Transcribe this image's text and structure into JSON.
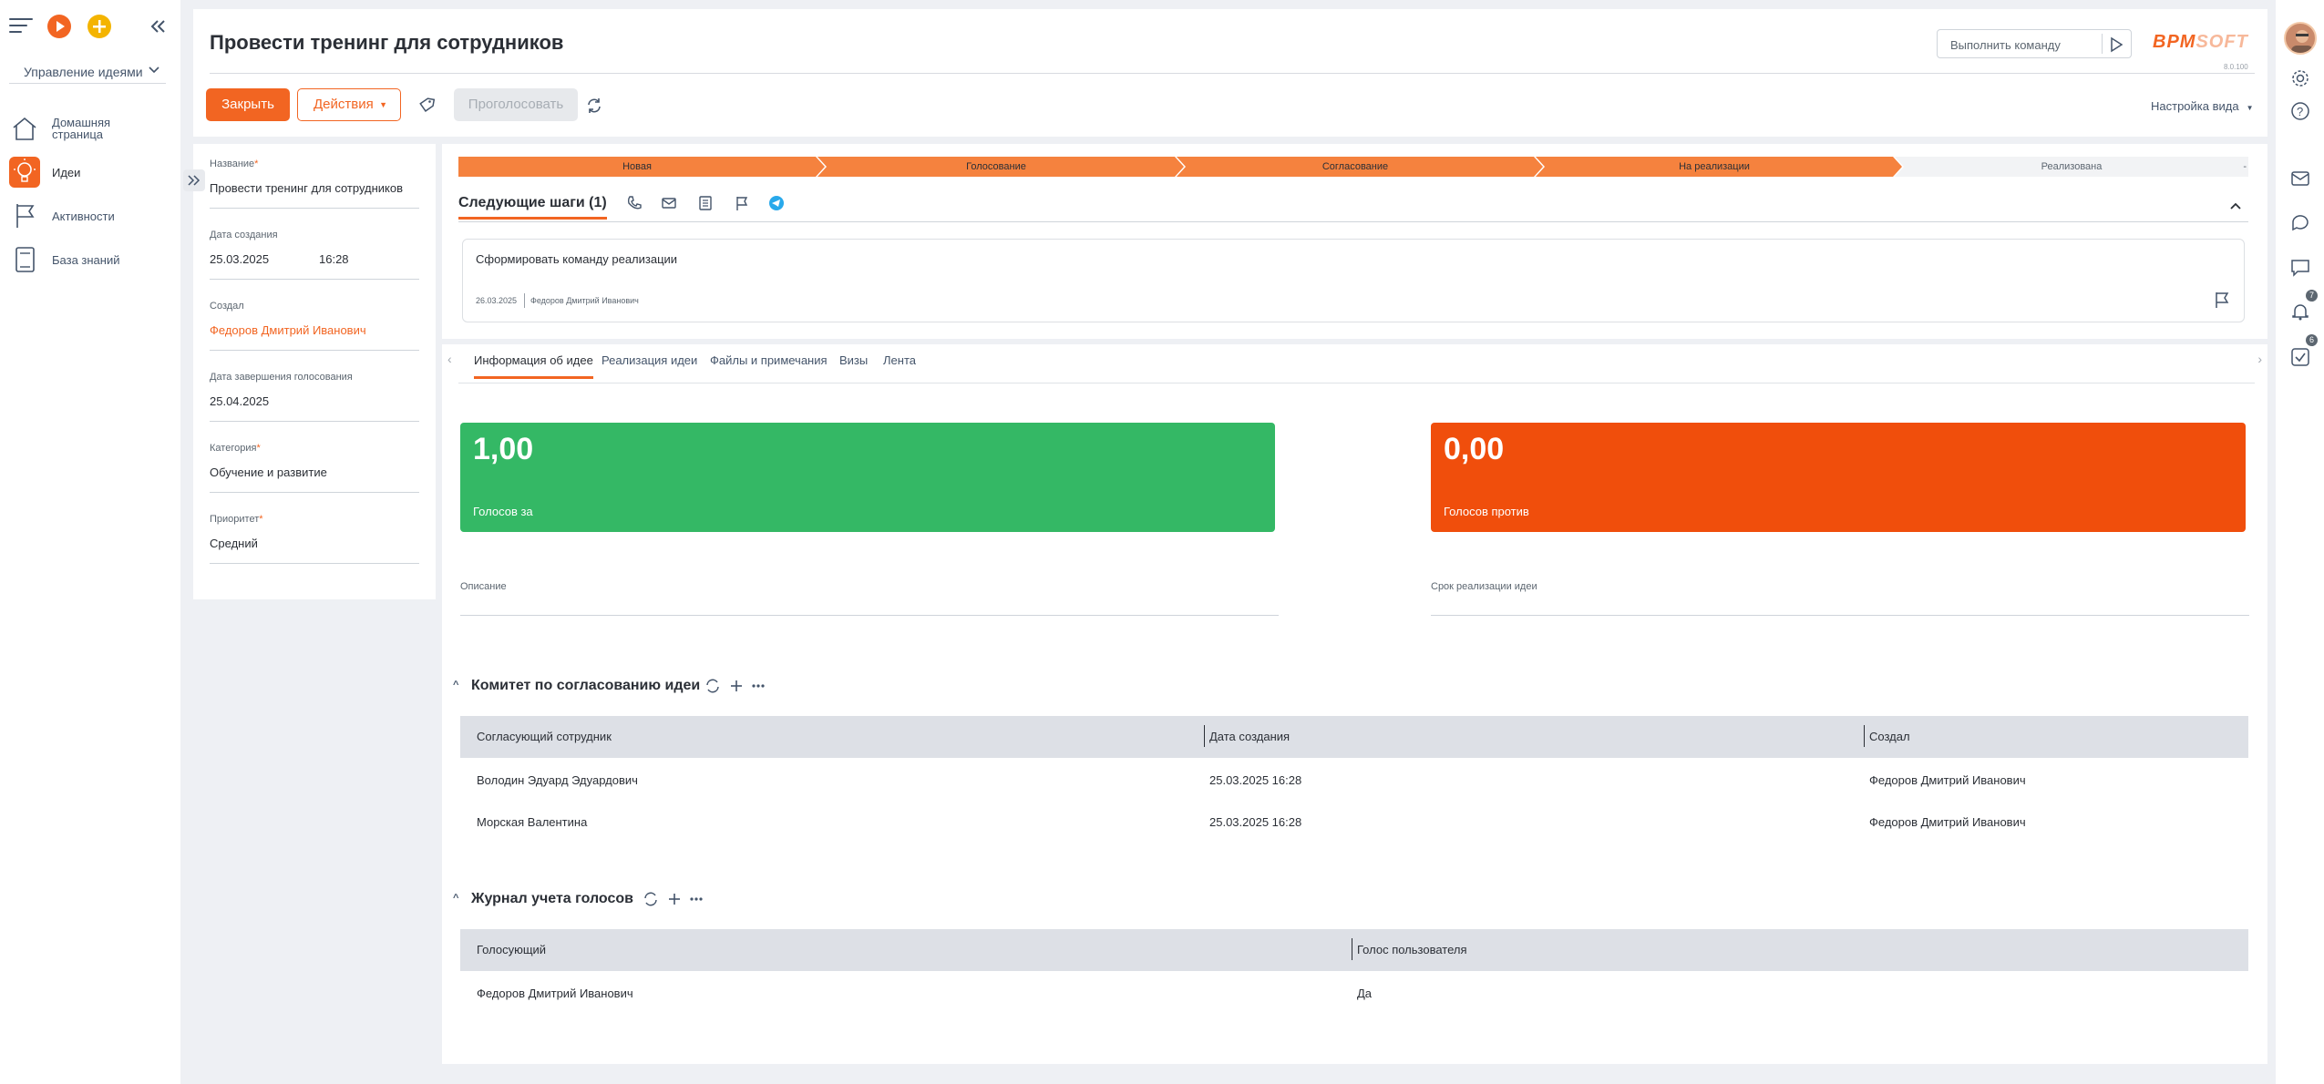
{
  "sidebar": {
    "module": "Управление идеями",
    "items": [
      {
        "label": "Домашняя страница",
        "icon": "home-icon"
      },
      {
        "label": "Идеи",
        "icon": "lightbulb-icon"
      },
      {
        "label": "Активности",
        "icon": "flag-icon"
      },
      {
        "label": "База знаний",
        "icon": "book-icon"
      }
    ]
  },
  "header": {
    "title": "Провести тренинг для сотрудников",
    "command_placeholder": "Выполнить команду",
    "logo_left": "BPM",
    "logo_right": "SOFT",
    "version": "8.0.100",
    "close_label": "Закрыть",
    "actions_label": "Действия",
    "vote_label": "Проголосовать",
    "view_settings_label": "Настройка вида"
  },
  "details": {
    "name_label": "Название",
    "name_value": "Провести тренинг для сотрудников",
    "created_label": "Дата создания",
    "created_date": "25.03.2025",
    "created_time": "16:28",
    "author_label": "Создал",
    "author_value": "Федоров Дмитрий Иванович",
    "voting_end_label": "Дата завершения голосования",
    "voting_end_value": "25.04.2025",
    "category_label": "Категория",
    "category_value": "Обучение и развитие",
    "priority_label": "Приоритет",
    "priority_value": "Средний"
  },
  "stages": [
    {
      "label": "Новая",
      "done": true
    },
    {
      "label": "Голосование",
      "done": true
    },
    {
      "label": "Согласование",
      "done": true
    },
    {
      "label": "На реализации",
      "done": true
    },
    {
      "label": "Реализована",
      "done": false
    }
  ],
  "next_steps": {
    "title": "Следующие шаги (1)",
    "task_title": "Сформировать команду реализации",
    "task_date": "26.03.2025",
    "task_owner": "Федоров Дмитрий Иванович"
  },
  "tabs": [
    "Информация об идее",
    "Реализация идеи",
    "Файлы и примечания",
    "Визы",
    "Лента"
  ],
  "votes": {
    "for_value": "1,00",
    "for_label": "Голосов за",
    "against_value": "0,00",
    "against_label": "Голосов против"
  },
  "fields": {
    "description_label": "Описание",
    "deadline_label": "Срок реализации идеи"
  },
  "committee": {
    "title": "Комитет по согласованию идеи",
    "columns": [
      "Согласующий сотрудник",
      "Дата создания",
      "Создал"
    ],
    "rows": [
      [
        "Володин Эдуард Эдуардович",
        "25.03.2025 16:28",
        "Федоров Дмитрий Иванович"
      ],
      [
        "Морская Валентина",
        "25.03.2025 16:28",
        "Федоров Дмитрий Иванович"
      ]
    ]
  },
  "votes_log": {
    "title": "Журнал учета голосов",
    "columns": [
      "Голосующий",
      "Голос пользователя"
    ],
    "rows": [
      [
        "Федоров Дмитрий Иванович",
        "Да"
      ]
    ]
  },
  "rail": {
    "notifications_count": "7",
    "tasks_count": "6"
  },
  "colors": {
    "accent": "#f26522",
    "vote_for": "#34b865",
    "vote_against": "#f04e0c"
  }
}
